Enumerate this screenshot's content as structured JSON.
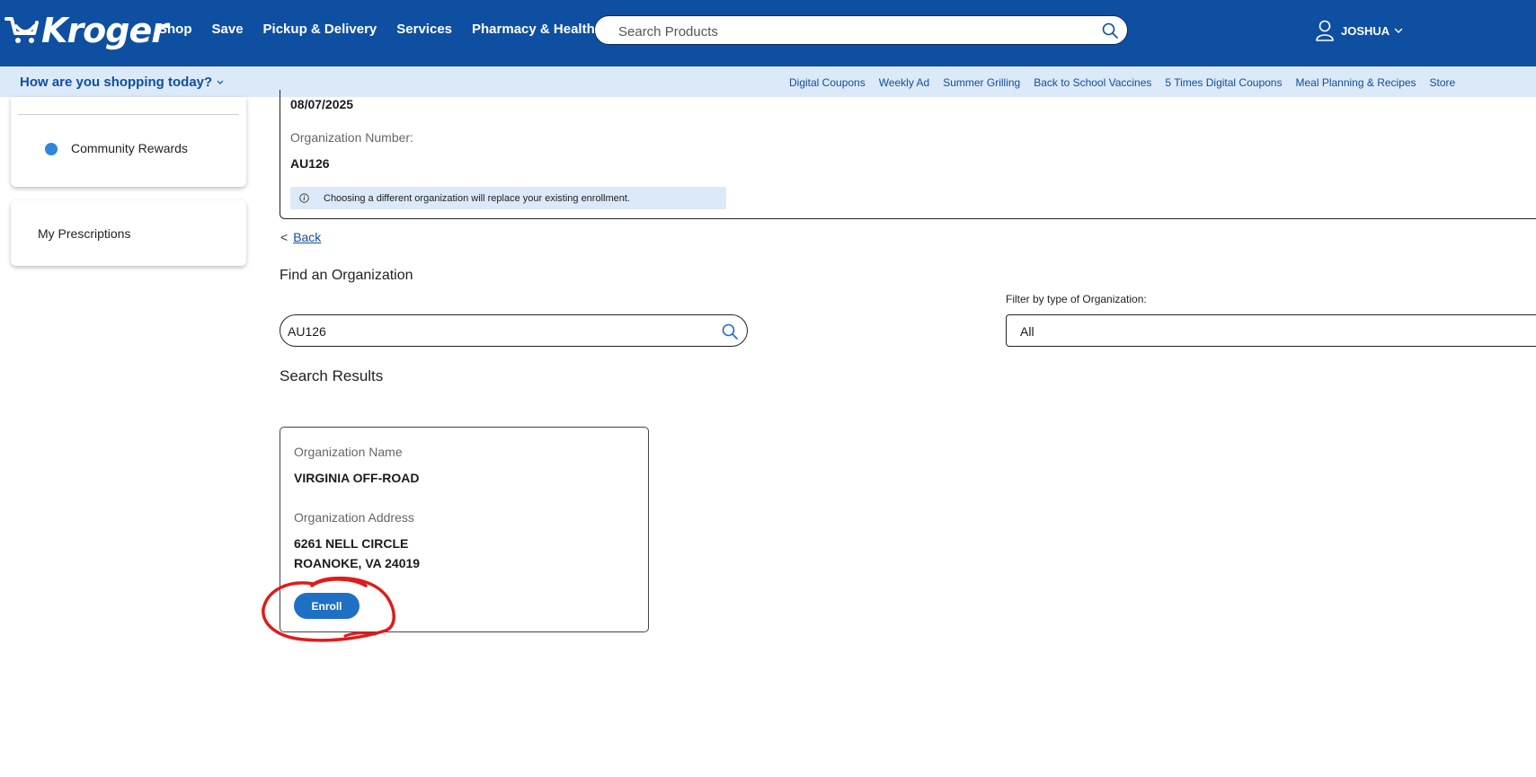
{
  "header": {
    "logo_text": "Kroger",
    "nav": [
      {
        "label": "Shop"
      },
      {
        "label": "Save"
      },
      {
        "label": "Pickup & Delivery"
      },
      {
        "label": "Services"
      },
      {
        "label": "Pharmacy & Health"
      }
    ],
    "search_placeholder": "Search Products",
    "user_name": "JOSHUA"
  },
  "subbar": {
    "shopping_prompt": "How are you shopping today?",
    "links": [
      {
        "label": "Digital Coupons"
      },
      {
        "label": "Weekly Ad"
      },
      {
        "label": "Summer Grilling"
      },
      {
        "label": "Back to School Vaccines"
      },
      {
        "label": "5 Times Digital Coupons"
      },
      {
        "label": "Meal Planning & Recipes"
      },
      {
        "label": "Store"
      }
    ]
  },
  "sidebar": {
    "community_rewards": "Community Rewards",
    "my_prescriptions": "My Prescriptions"
  },
  "enrollment": {
    "date": "08/07/2025",
    "org_number_label": "Organization Number:",
    "org_number": "AU126",
    "notice": "Choosing a different organization will replace your existing enrollment."
  },
  "back": {
    "prefix": "<",
    "label": "Back"
  },
  "find": {
    "title": "Find an Organization",
    "search_value": "AU126",
    "filter_label": "Filter by type of Organization:",
    "filter_value": "All"
  },
  "results": {
    "title": "Search Results",
    "name_label": "Organization Name",
    "name": "VIRGINIA OFF-ROAD",
    "address_label": "Organization Address",
    "address_line1": "6261 NELL CIRCLE",
    "address_line2": "ROANOKE, VA 24019",
    "enroll_label": "Enroll"
  },
  "colors": {
    "brand_blue": "#0f4fa1",
    "subbar_bg": "#dbe9f8",
    "button_blue": "#1f6fc5",
    "annotation_red": "#e01b1b"
  }
}
